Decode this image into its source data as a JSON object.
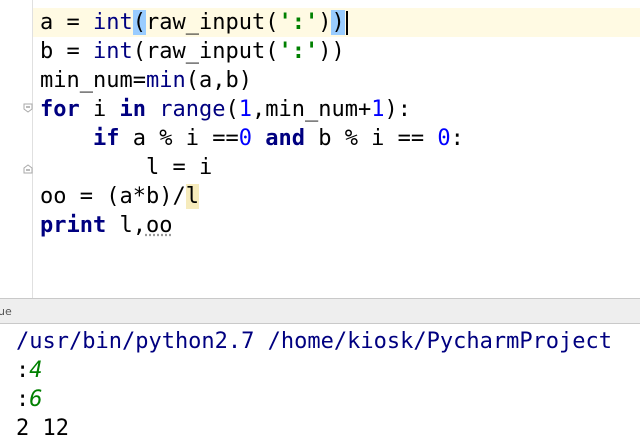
{
  "editor": {
    "lines": [
      {
        "id": "line-1"
      },
      {
        "id": "line-2"
      }
    ],
    "l1": {
      "a": "a = ",
      "int": "int",
      "open": "(",
      "raw": "raw_input",
      "p2": "(",
      "str": "':'",
      "close1": ")",
      "close2": ")"
    },
    "l2": {
      "a": "b = ",
      "int": "int",
      "open": "(",
      "raw": "raw_input",
      "p2": "(",
      "str": "':'",
      "close": "))"
    },
    "l3": {
      "a": "min_num=",
      "min": "min",
      "rest": "(a,b)"
    },
    "l4": {
      "for": "for",
      "mid": " i ",
      "in": "in",
      "sp": " ",
      "range": "range",
      "p1": "(",
      "n1": "1",
      "mid2": ",min_num+",
      "n2": "1",
      "end": "):"
    },
    "l5": {
      "ind": "    ",
      "if": "if",
      "mid": " a % i ==",
      "n0": "0",
      "sp": " ",
      "and": "and",
      "mid2": " b % i == ",
      "n1": "0",
      "end": ":"
    },
    "l6": {
      "ind": "        ",
      "text": "l = i"
    },
    "l7": {
      "pre": "oo = (a*b)/",
      "l": "l"
    },
    "l8": {
      "print": "print",
      "sp": " l,",
      "oo": "oo"
    }
  },
  "divider": {
    "label": "ue"
  },
  "console": {
    "path": "/usr/bin/python2.7 /home/kiosk/PycharmProject",
    "prompt1": ":",
    "input1": "4",
    "prompt2": ":",
    "input2": "6",
    "output": "2 12"
  },
  "colors": {
    "keyword": "#000080",
    "number": "#0000ff",
    "string": "#008000",
    "caret_line": "#fffae3",
    "paren_match": "#99ccff"
  }
}
